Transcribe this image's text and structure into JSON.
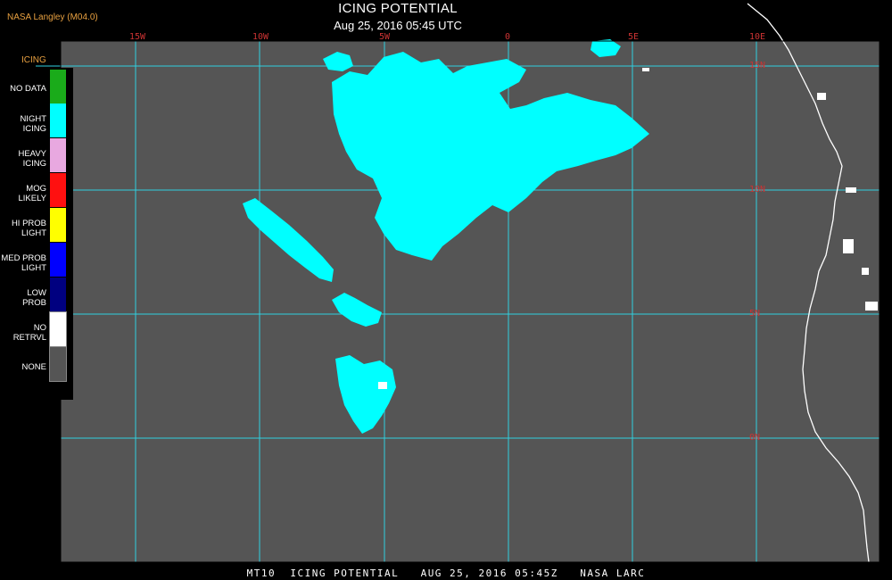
{
  "credit": "NASA Langley (M04.0)",
  "title": "ICING POTENTIAL",
  "subtitle": "Aug 25, 2016 05:45 UTC",
  "footer": "MT10  ICING POTENTIAL   AUG 25, 2016 05:45Z   NASA LARC",
  "legend": {
    "title": "ICING",
    "items": [
      {
        "label": "NO DATA",
        "color": "#1aab1a"
      },
      {
        "label": "NIGHT\nICING",
        "color": "#00ffff"
      },
      {
        "label": "HEAVY\nICING",
        "color": "#e8a8e0"
      },
      {
        "label": "MOG\nLIKELY",
        "color": "#ff1010"
      },
      {
        "label": "HI PROB\nLIGHT",
        "color": "#ffff00"
      },
      {
        "label": "MED PROB\nLIGHT",
        "color": "#0000ff"
      },
      {
        "label": "LOW\nPROB",
        "color": "#000080"
      },
      {
        "label": "NO\nRETRVL",
        "color": "#ffffff"
      },
      {
        "label": "NONE",
        "color": "#555555"
      }
    ]
  },
  "longitude_labels": [
    "15W",
    "10W",
    "5W",
    "0",
    "5E",
    "10E"
  ],
  "latitude_labels": [
    "15N",
    "10N",
    "5N",
    "0N"
  ],
  "colors": {
    "background": "#555555",
    "grid": "#30d0e0",
    "icing": "#00ffff",
    "coast": "#ffffff",
    "label": "#cc3333"
  }
}
